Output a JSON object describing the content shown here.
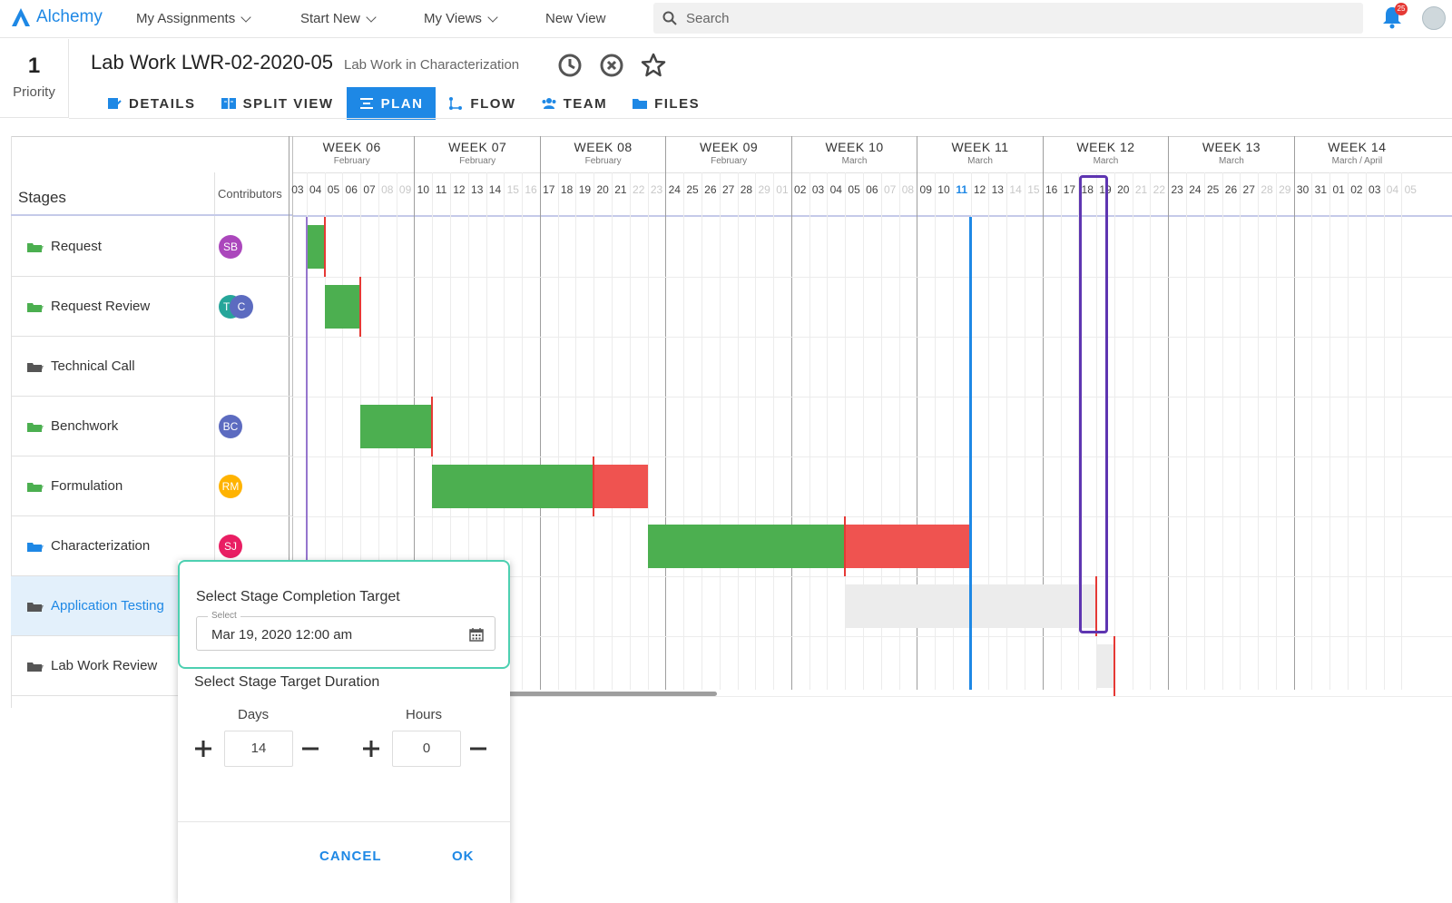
{
  "nav": {
    "logo": "Alchemy",
    "items": [
      "My Assignments",
      "Start New",
      "My Views",
      "New View"
    ],
    "search_placeholder": "Search",
    "notification_count": "25"
  },
  "header": {
    "priority_value": "1",
    "priority_label": "Priority",
    "title": "Lab Work LWR-02-2020-05",
    "subtitle": "Lab Work in Characterization"
  },
  "tabs": [
    "DETAILS",
    "SPLIT VIEW",
    "PLAN",
    "FLOW",
    "TEAM",
    "FILES"
  ],
  "active_tab": "PLAN",
  "gantt": {
    "stages_label": "Stages",
    "contributors_label": "Contributors",
    "weeks": [
      {
        "title": "WEEK 06",
        "month": "February"
      },
      {
        "title": "WEEK 07",
        "month": "February"
      },
      {
        "title": "WEEK 08",
        "month": "February"
      },
      {
        "title": "WEEK 09",
        "month": "February"
      },
      {
        "title": "WEEK 10",
        "month": "March"
      },
      {
        "title": "WEEK 11",
        "month": "March"
      },
      {
        "title": "WEEK 12",
        "month": "March"
      },
      {
        "title": "WEEK 13",
        "month": "March"
      },
      {
        "title": "WEEK 14",
        "month": "March / April"
      }
    ],
    "days": [
      "03",
      "04",
      "05",
      "06",
      "07",
      "08",
      "09",
      "10",
      "11",
      "12",
      "13",
      "14",
      "15",
      "16",
      "17",
      "18",
      "19",
      "20",
      "21",
      "22",
      "23",
      "24",
      "25",
      "26",
      "27",
      "28",
      "29",
      "01",
      "02",
      "03",
      "04",
      "05",
      "06",
      "07",
      "08",
      "09",
      "10",
      "11",
      "12",
      "13",
      "14",
      "15",
      "16",
      "17",
      "18",
      "19",
      "20",
      "21",
      "22",
      "23",
      "24",
      "25",
      "26",
      "27",
      "28",
      "29",
      "30",
      "31",
      "01",
      "02",
      "03",
      "04",
      "05"
    ],
    "stages": [
      {
        "name": "Request",
        "contributors": [
          {
            "initials": "SB",
            "color": "#ab47bc"
          }
        ],
        "status": "done"
      },
      {
        "name": "Request Review",
        "contributors": [
          {
            "initials": "TD",
            "color": "#26a69a"
          },
          {
            "initials": "C",
            "color": "#5c6bc0"
          }
        ],
        "status": "done"
      },
      {
        "name": "Technical Call",
        "contributors": [],
        "status": "none"
      },
      {
        "name": "Benchwork",
        "contributors": [
          {
            "initials": "BC",
            "color": "#5c6bc0"
          }
        ],
        "status": "done"
      },
      {
        "name": "Formulation",
        "contributors": [
          {
            "initials": "RM",
            "color": "#ffb300"
          }
        ],
        "status": "done"
      },
      {
        "name": "Characterization",
        "contributors": [
          {
            "initials": "SJ",
            "color": "#e91e63"
          }
        ],
        "status": "active"
      },
      {
        "name": "Application Testing",
        "contributors": [],
        "status": "none"
      },
      {
        "name": "Lab Work Review",
        "contributors": [],
        "status": "none"
      }
    ]
  },
  "popup": {
    "completion_title": "Select Stage Completion Target",
    "select_legend": "Select",
    "completion_value": "Mar 19, 2020 12:00 am",
    "duration_title": "Select Stage Target Duration",
    "days_label": "Days",
    "days_value": "14",
    "hours_label": "Hours",
    "hours_value": "0",
    "cancel_label": "CANCEL",
    "ok_label": "OK"
  },
  "colors": {
    "accent": "#1e88e5",
    "done": "#4caf50",
    "late": "#ef5350",
    "highlight": "#5e35b1",
    "focus": "#4dd0b1"
  }
}
